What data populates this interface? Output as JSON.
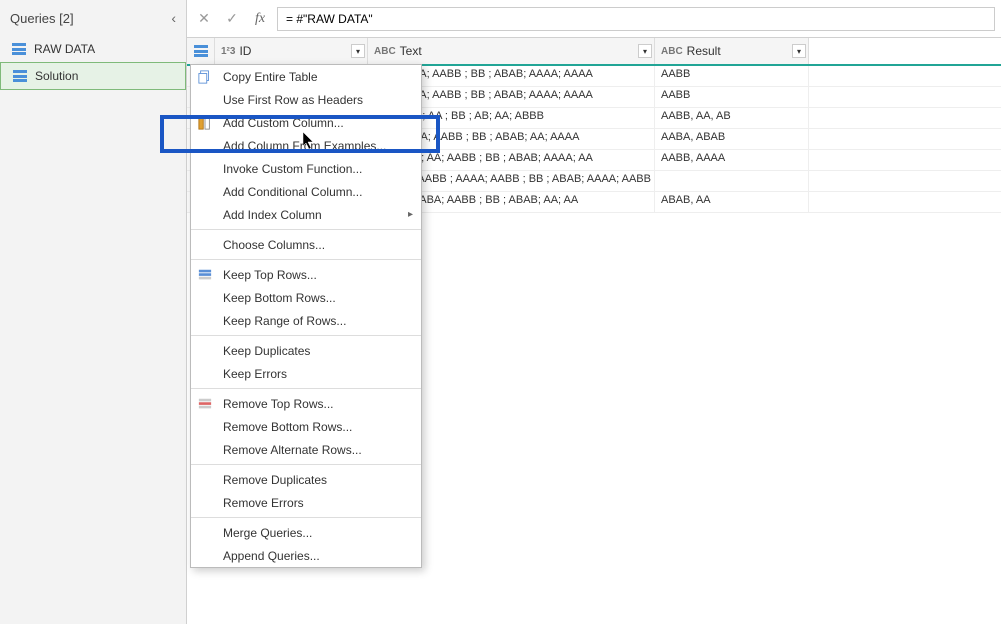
{
  "sidebar": {
    "title": "Queries [2]",
    "items": [
      {
        "label": "RAW DATA",
        "selected": false
      },
      {
        "label": "Solution",
        "selected": true
      }
    ]
  },
  "formula_bar": {
    "value": "= #\"RAW DATA\""
  },
  "columns": [
    {
      "name": "ID",
      "type": "1²3"
    },
    {
      "name": "Text",
      "type": "ABC"
    },
    {
      "name": "Result",
      "type": "ABC"
    }
  ],
  "rows": [
    {
      "text": "AABB ; AA; AABB ; BB ; ABAB; AAAA; AAAA",
      "result": "AABB"
    },
    {
      "text": "AABB ; AA; AABB ; BB ; ABAB; AAAA; AAAA",
      "result": "AABB"
    },
    {
      "text": "\\ABB ; AA; AA ; BB ; AB; AA; ABBB",
      "result": "AABB, AA, AB"
    },
    {
      "text": "; \\ABA ; AA; AABB ; BB ; ABAB; AA; AAAA",
      "result": "AABA, ABAB"
    },
    {
      "text": "3 ; AABB ; AA; AABB ; BB ; ABAB; AAAA; AA",
      "result": "AABB, AAAA"
    },
    {
      "text": "; AABB ; AABB ; AAAA; AABB ; BB ; ABAB; AAAA; AABB",
      "result": ""
    },
    {
      "text": "AABB ; AABA; AABB ; BB ; ABAB; AA; AA",
      "result": "ABAB, AA"
    }
  ],
  "context_menu": {
    "groups": [
      [
        {
          "label": "Copy Entire Table",
          "icon": "copy"
        },
        {
          "label": "Use First Row as Headers",
          "icon": ""
        },
        {
          "label": "Add Custom Column...",
          "icon": "custom-col"
        },
        {
          "label": "Add Column From Examples...",
          "icon": ""
        },
        {
          "label": "Invoke Custom Function...",
          "icon": ""
        },
        {
          "label": "Add Conditional Column...",
          "icon": ""
        },
        {
          "label": "Add Index Column",
          "icon": "",
          "submenu": true
        }
      ],
      [
        {
          "label": "Choose Columns...",
          "icon": ""
        }
      ],
      [
        {
          "label": "Keep Top Rows...",
          "icon": "keep-rows"
        },
        {
          "label": "Keep Bottom Rows...",
          "icon": ""
        },
        {
          "label": "Keep Range of Rows...",
          "icon": ""
        }
      ],
      [
        {
          "label": "Keep Duplicates",
          "icon": ""
        },
        {
          "label": "Keep Errors",
          "icon": ""
        }
      ],
      [
        {
          "label": "Remove Top Rows...",
          "icon": "remove-rows"
        },
        {
          "label": "Remove Bottom Rows...",
          "icon": ""
        },
        {
          "label": "Remove Alternate Rows...",
          "icon": ""
        }
      ],
      [
        {
          "label": "Remove Duplicates",
          "icon": ""
        },
        {
          "label": "Remove Errors",
          "icon": ""
        }
      ],
      [
        {
          "label": "Merge Queries...",
          "icon": ""
        },
        {
          "label": "Append Queries...",
          "icon": ""
        }
      ]
    ]
  }
}
